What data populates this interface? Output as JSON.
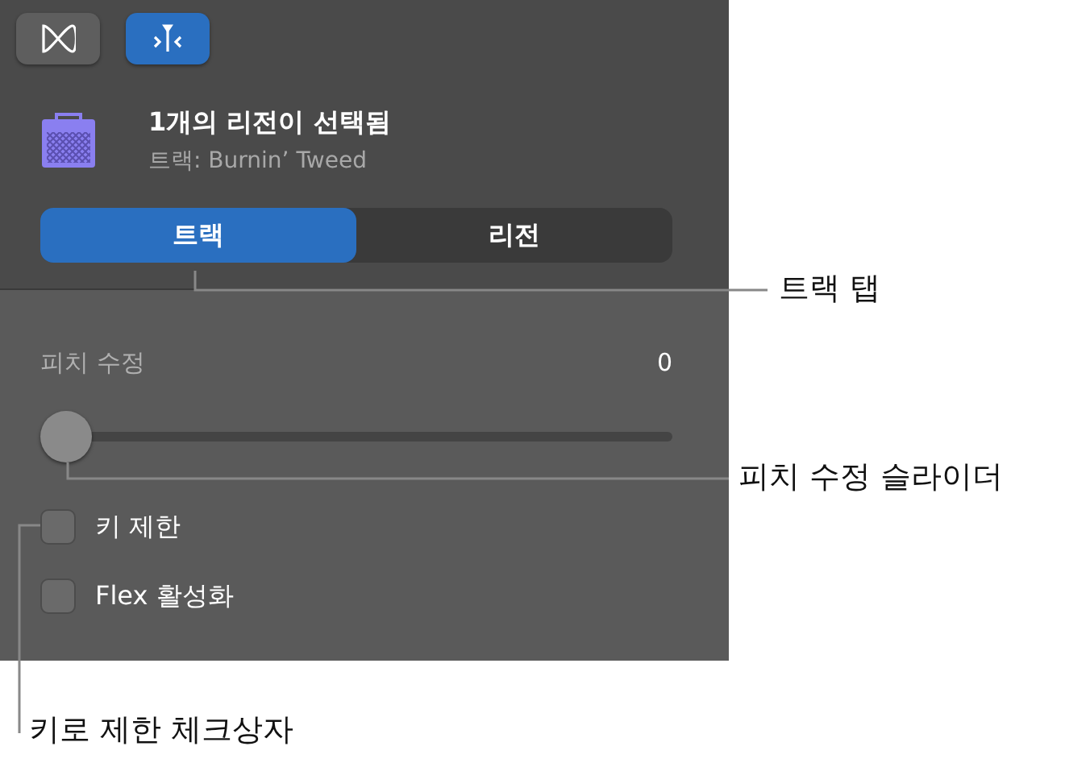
{
  "mode_buttons": [
    {
      "selected": false
    },
    {
      "selected": true
    }
  ],
  "header": {
    "title": "1개의 리전이 선택됨",
    "subtitle": "트랙: Burnin’ Tweed"
  },
  "tabs": [
    {
      "label": "트랙",
      "selected": true
    },
    {
      "label": "리전",
      "selected": false
    }
  ],
  "pitch": {
    "label": "피치 수정",
    "value": "0",
    "level": 0
  },
  "checkboxes": [
    {
      "label": "키 제한",
      "checked": false
    },
    {
      "label": "Flex 활성화",
      "checked": false
    }
  ],
  "callouts": [
    {
      "text": "트랙 탭"
    },
    {
      "text": "피치 수정 슬라이더"
    },
    {
      "text": "키로 제한 체크상자"
    }
  ]
}
